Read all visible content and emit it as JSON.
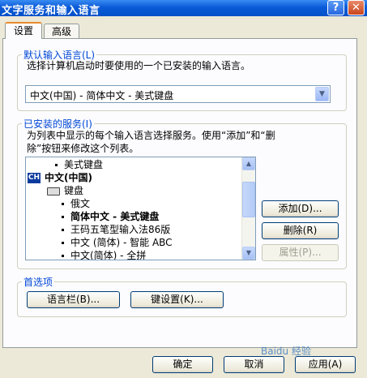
{
  "window": {
    "title": "文字服务和输入语言",
    "help_btn": "?",
    "close_btn": "✕"
  },
  "tabs": [
    {
      "label": "设置"
    },
    {
      "label": "高级"
    }
  ],
  "default_lang": {
    "legend": "默认输入语言(L)",
    "desc": "选择计算机启动时要使用的一个已安装的输入语言。",
    "selected": "中文(中国) - 简体中文 - 美式键盘"
  },
  "installed": {
    "legend": "已安装的服务(I)",
    "desc_line1": "为列表中显示的每个输入语言选择服务。使用“添加”和“删",
    "desc_line2": "除”按钮来修改这个列表。",
    "items": [
      "美式键盘",
      "中文(中国)",
      "键盘",
      "俄文",
      "简体中文 - 美式键盘",
      "王码五笔型输入法86版",
      "中文 (简体) - 智能 ABC",
      "中文(简体) - 全拼"
    ],
    "lang_badge": "CH",
    "add_btn": "添加(D)...",
    "remove_btn": "删除(R)",
    "props_btn": "属性(P)..."
  },
  "prefs": {
    "legend": "首选项",
    "langbar_btn": "语言栏(B)...",
    "keyset_btn": "键设置(K)..."
  },
  "footer": {
    "ok": "确定",
    "cancel": "取消",
    "apply": "应用(A)"
  },
  "watermark": "Baidu 经验"
}
